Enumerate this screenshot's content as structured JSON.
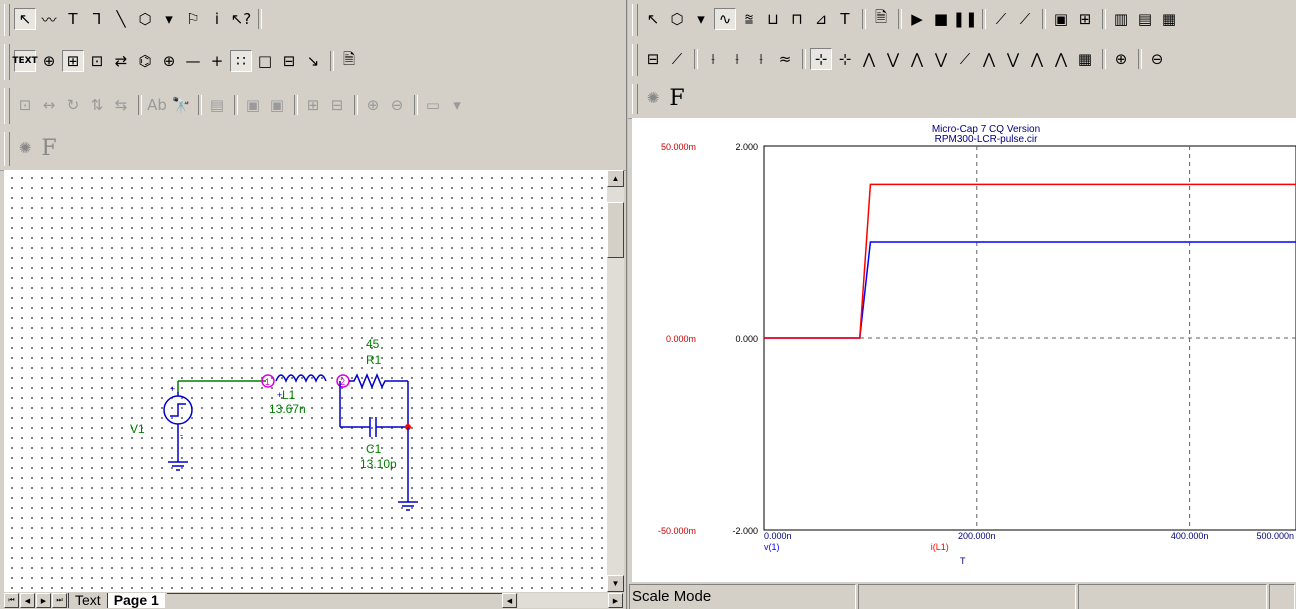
{
  "schematic": {
    "toolbar_row1": [
      "↖",
      "〰",
      "T",
      "⅂",
      "╲",
      "⬡",
      "▾",
      "⚐",
      "i",
      "↖?"
    ],
    "toolbar_row2": [
      "TEXT",
      "⊕",
      "⊞",
      "⊡",
      "⇄",
      "⌬",
      "⊕",
      "—",
      "+",
      "∷",
      "□",
      "⊟",
      "↘",
      "🗎"
    ],
    "toolbar_row3": [
      "⊡",
      "↔",
      "↻",
      "⇅",
      "⇆",
      "Ab",
      "🔭",
      "▤",
      "▣",
      "▣",
      "⊞",
      "⊟",
      "⊕",
      "⊖",
      "▭",
      "▾"
    ],
    "f_label": "F",
    "circuit": {
      "v1_label": "V1",
      "l1_label": "L1",
      "l1_value": "13.67n",
      "r1_label": "R1",
      "r1_value": "45",
      "c1_label": "C1",
      "c1_value": "13.10p",
      "node1": "1",
      "node2": "2"
    },
    "tabs": [
      "Text",
      "Page 1"
    ]
  },
  "analysis": {
    "toolbar_row1": [
      "↖",
      "⬡",
      "▾",
      "∿",
      "⩰",
      "⊔",
      "⊓",
      "⊿",
      "T",
      "🗎",
      "▶",
      "■",
      "❚❚",
      "⟋",
      "⟋",
      "▣",
      "⊞",
      "▥",
      "▤",
      "▦"
    ],
    "toolbar_row2": [
      "⊟",
      "⟋",
      "⟊",
      "⟊",
      "⟊",
      "≈",
      "⊹",
      "⊹",
      "⋀",
      "⋁",
      "⋀",
      "⋁",
      "⟋",
      "⋀",
      "⋁",
      "⋀",
      "⋀",
      "▦",
      "⊕",
      "⊖"
    ],
    "f_label": "F",
    "status_mode": "Scale Mode"
  },
  "chart_data": {
    "type": "line",
    "title": "Micro-Cap 7 CQ Version",
    "subtitle": "RPM300-LCR-pulse.cir",
    "x": [
      0,
      90,
      100,
      500
    ],
    "series": [
      {
        "name": "v(1)",
        "color": "#0000ff",
        "values": [
          0,
          0,
          1.0,
          1.0
        ]
      },
      {
        "name": "i(L1)",
        "color": "#ff0000",
        "values": [
          0,
          0,
          0.04,
          0.04
        ]
      }
    ],
    "xlim": [
      0,
      500
    ],
    "xticks": [
      "0.000n",
      "200.000n",
      "400.000n",
      "500.000n"
    ],
    "xlabel": "T",
    "left_axis": {
      "ticks": [
        "50.000m",
        "0.000m",
        "-50.000m"
      ],
      "color": "#cc0000"
    },
    "right_axis": {
      "ticks": [
        "2.000",
        "0.000",
        "-2.000"
      ],
      "color": "#000000"
    },
    "grid": true,
    "legend_position": "bottom-left"
  }
}
